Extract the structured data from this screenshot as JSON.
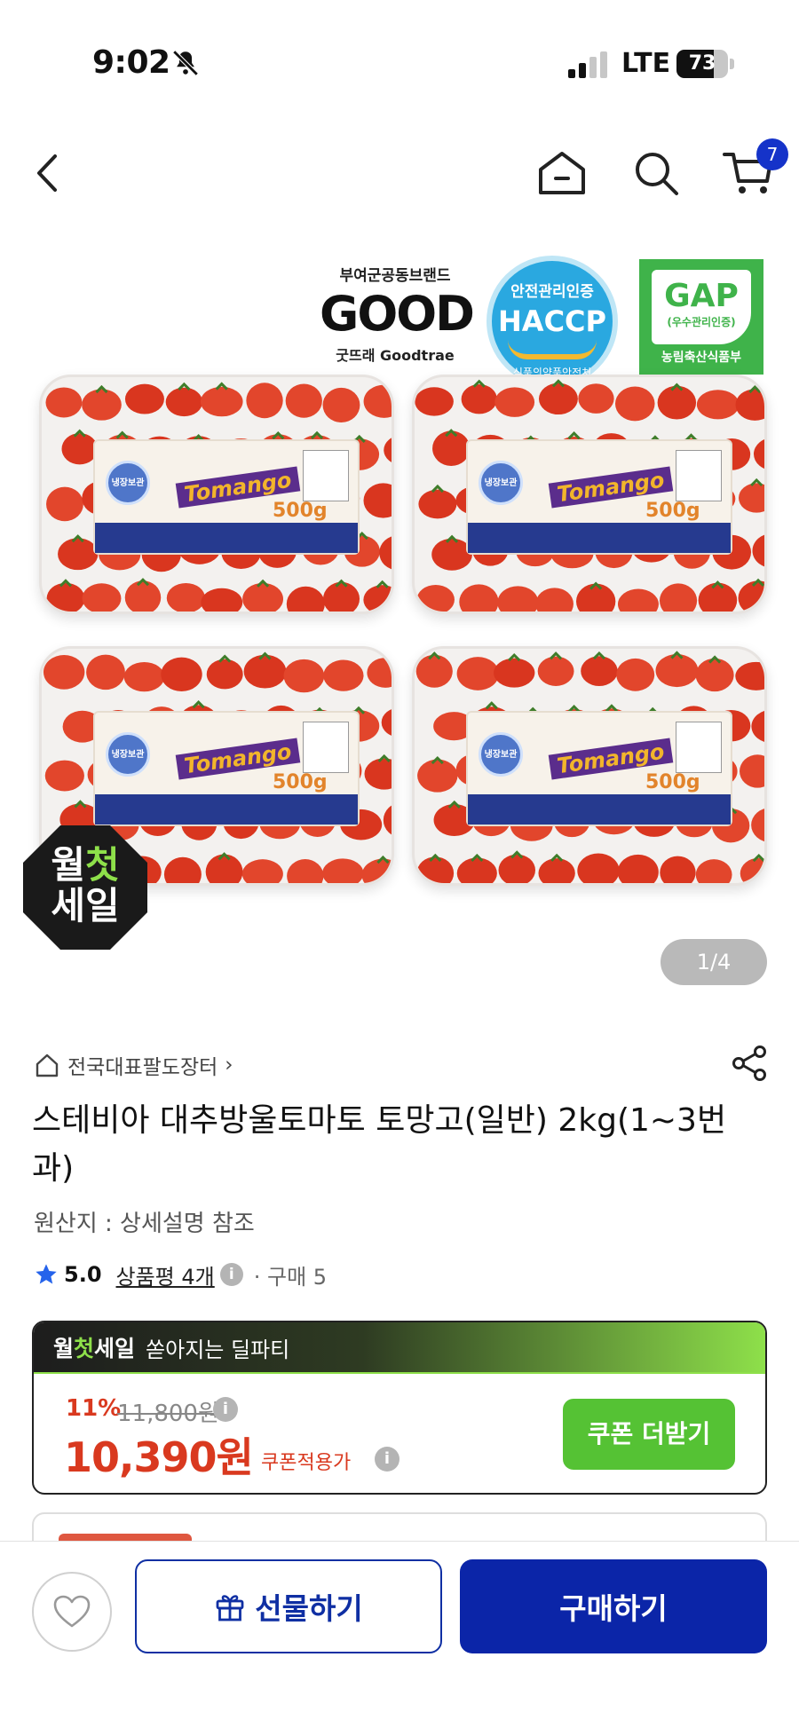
{
  "status_bar": {
    "time": "9:02",
    "network": "LTE",
    "battery": "73",
    "battery_level": 0.73
  },
  "nav": {
    "cart_count": "7"
  },
  "hero": {
    "cert_good_brand": "부여군공동브랜드",
    "cert_good_logo": "GOOD",
    "cert_good_sub": "굿뜨래 Goodtrae",
    "haccp_top": "안전관리인증",
    "haccp_main": "HACCP",
    "haccp_bottom": "식품의약품안전처",
    "gap_main": "GAP",
    "gap_sub": "(우수관리인증)",
    "gap_bottom": "농림축산식품부",
    "tray_badge": "냉장보관",
    "tray_brand": "Tomango",
    "tray_weight": "500g",
    "sale_badge_line1_a": "월",
    "sale_badge_line1_b": "첫",
    "sale_badge_line2": "세일",
    "pager": "1/4"
  },
  "product": {
    "store": "전국대표팔도장터",
    "store_chevron": "›",
    "title": "스테비아 대추방울토마토 토망고(일반) 2kg(1~3번과)",
    "origin": "원산지 : 상세설명 참조",
    "rating": "5.0",
    "reviews": "상품평 4개",
    "sales": "· 구매 5"
  },
  "deal": {
    "brand_a": "월",
    "brand_b": "첫",
    "brand_c": "세일",
    "tagline": "쏟아지는 딜파티",
    "discount": "11%",
    "original_price": "11,800원",
    "price": "10,390원",
    "price_label": "쿠폰적용가",
    "coupon_button": "쿠폰 더받기"
  },
  "bottom_bar": {
    "gift_button": "선물하기",
    "buy_button": "구매하기"
  },
  "colors": {
    "brand_blue": "#0b25a8",
    "sale_red": "#d9391f",
    "coupon_green": "#55c234",
    "accent_lime": "#8ee04a"
  },
  "icons": [
    "bell-slash-icon",
    "signal-icon",
    "back-icon",
    "home-icon",
    "search-icon",
    "cart-icon",
    "share-icon",
    "star-icon",
    "info-icon",
    "heart-icon",
    "gift-icon",
    "store-home-icon"
  ]
}
